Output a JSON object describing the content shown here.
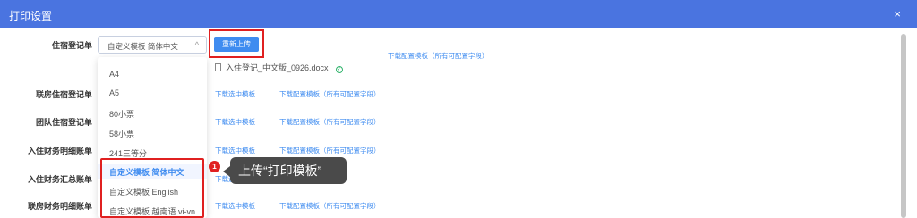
{
  "dialog": {
    "title": "打印设置",
    "close_icon": "×"
  },
  "rows": [
    {
      "label": "住宿登记单"
    },
    {
      "label": "联房住宿登记单"
    },
    {
      "label": "团队住宿登记单"
    },
    {
      "label": "入住财务明细账单"
    },
    {
      "label": "入住财务汇总账单"
    },
    {
      "label": "联房财务明细账单"
    }
  ],
  "select": {
    "value": "自定义模板 简体中文",
    "chevron": "^"
  },
  "upload": {
    "label": "重新上传"
  },
  "download_config_right": "下载配置模板（所有可配置字段）",
  "file": {
    "name": "入住登记_中文版_0926.docx"
  },
  "links": {
    "download_selected": "下载选中模板",
    "download_config": "下载配置模板（所有可配置字段）"
  },
  "dropdown_options": [
    "A4",
    "A5",
    "80小票",
    "58小票",
    "241三等分",
    "自定义模板 简体中文",
    "自定义模板 English",
    "自定义模板 越南语 vi-vn"
  ],
  "selected_index": 5,
  "annotation": {
    "step": "1",
    "text": "上传“打印模板”"
  },
  "colors": {
    "header": "#4a74e0",
    "primary": "#3f8cf0",
    "highlight": "#e02020",
    "tooltip": "#4a4a4a"
  }
}
